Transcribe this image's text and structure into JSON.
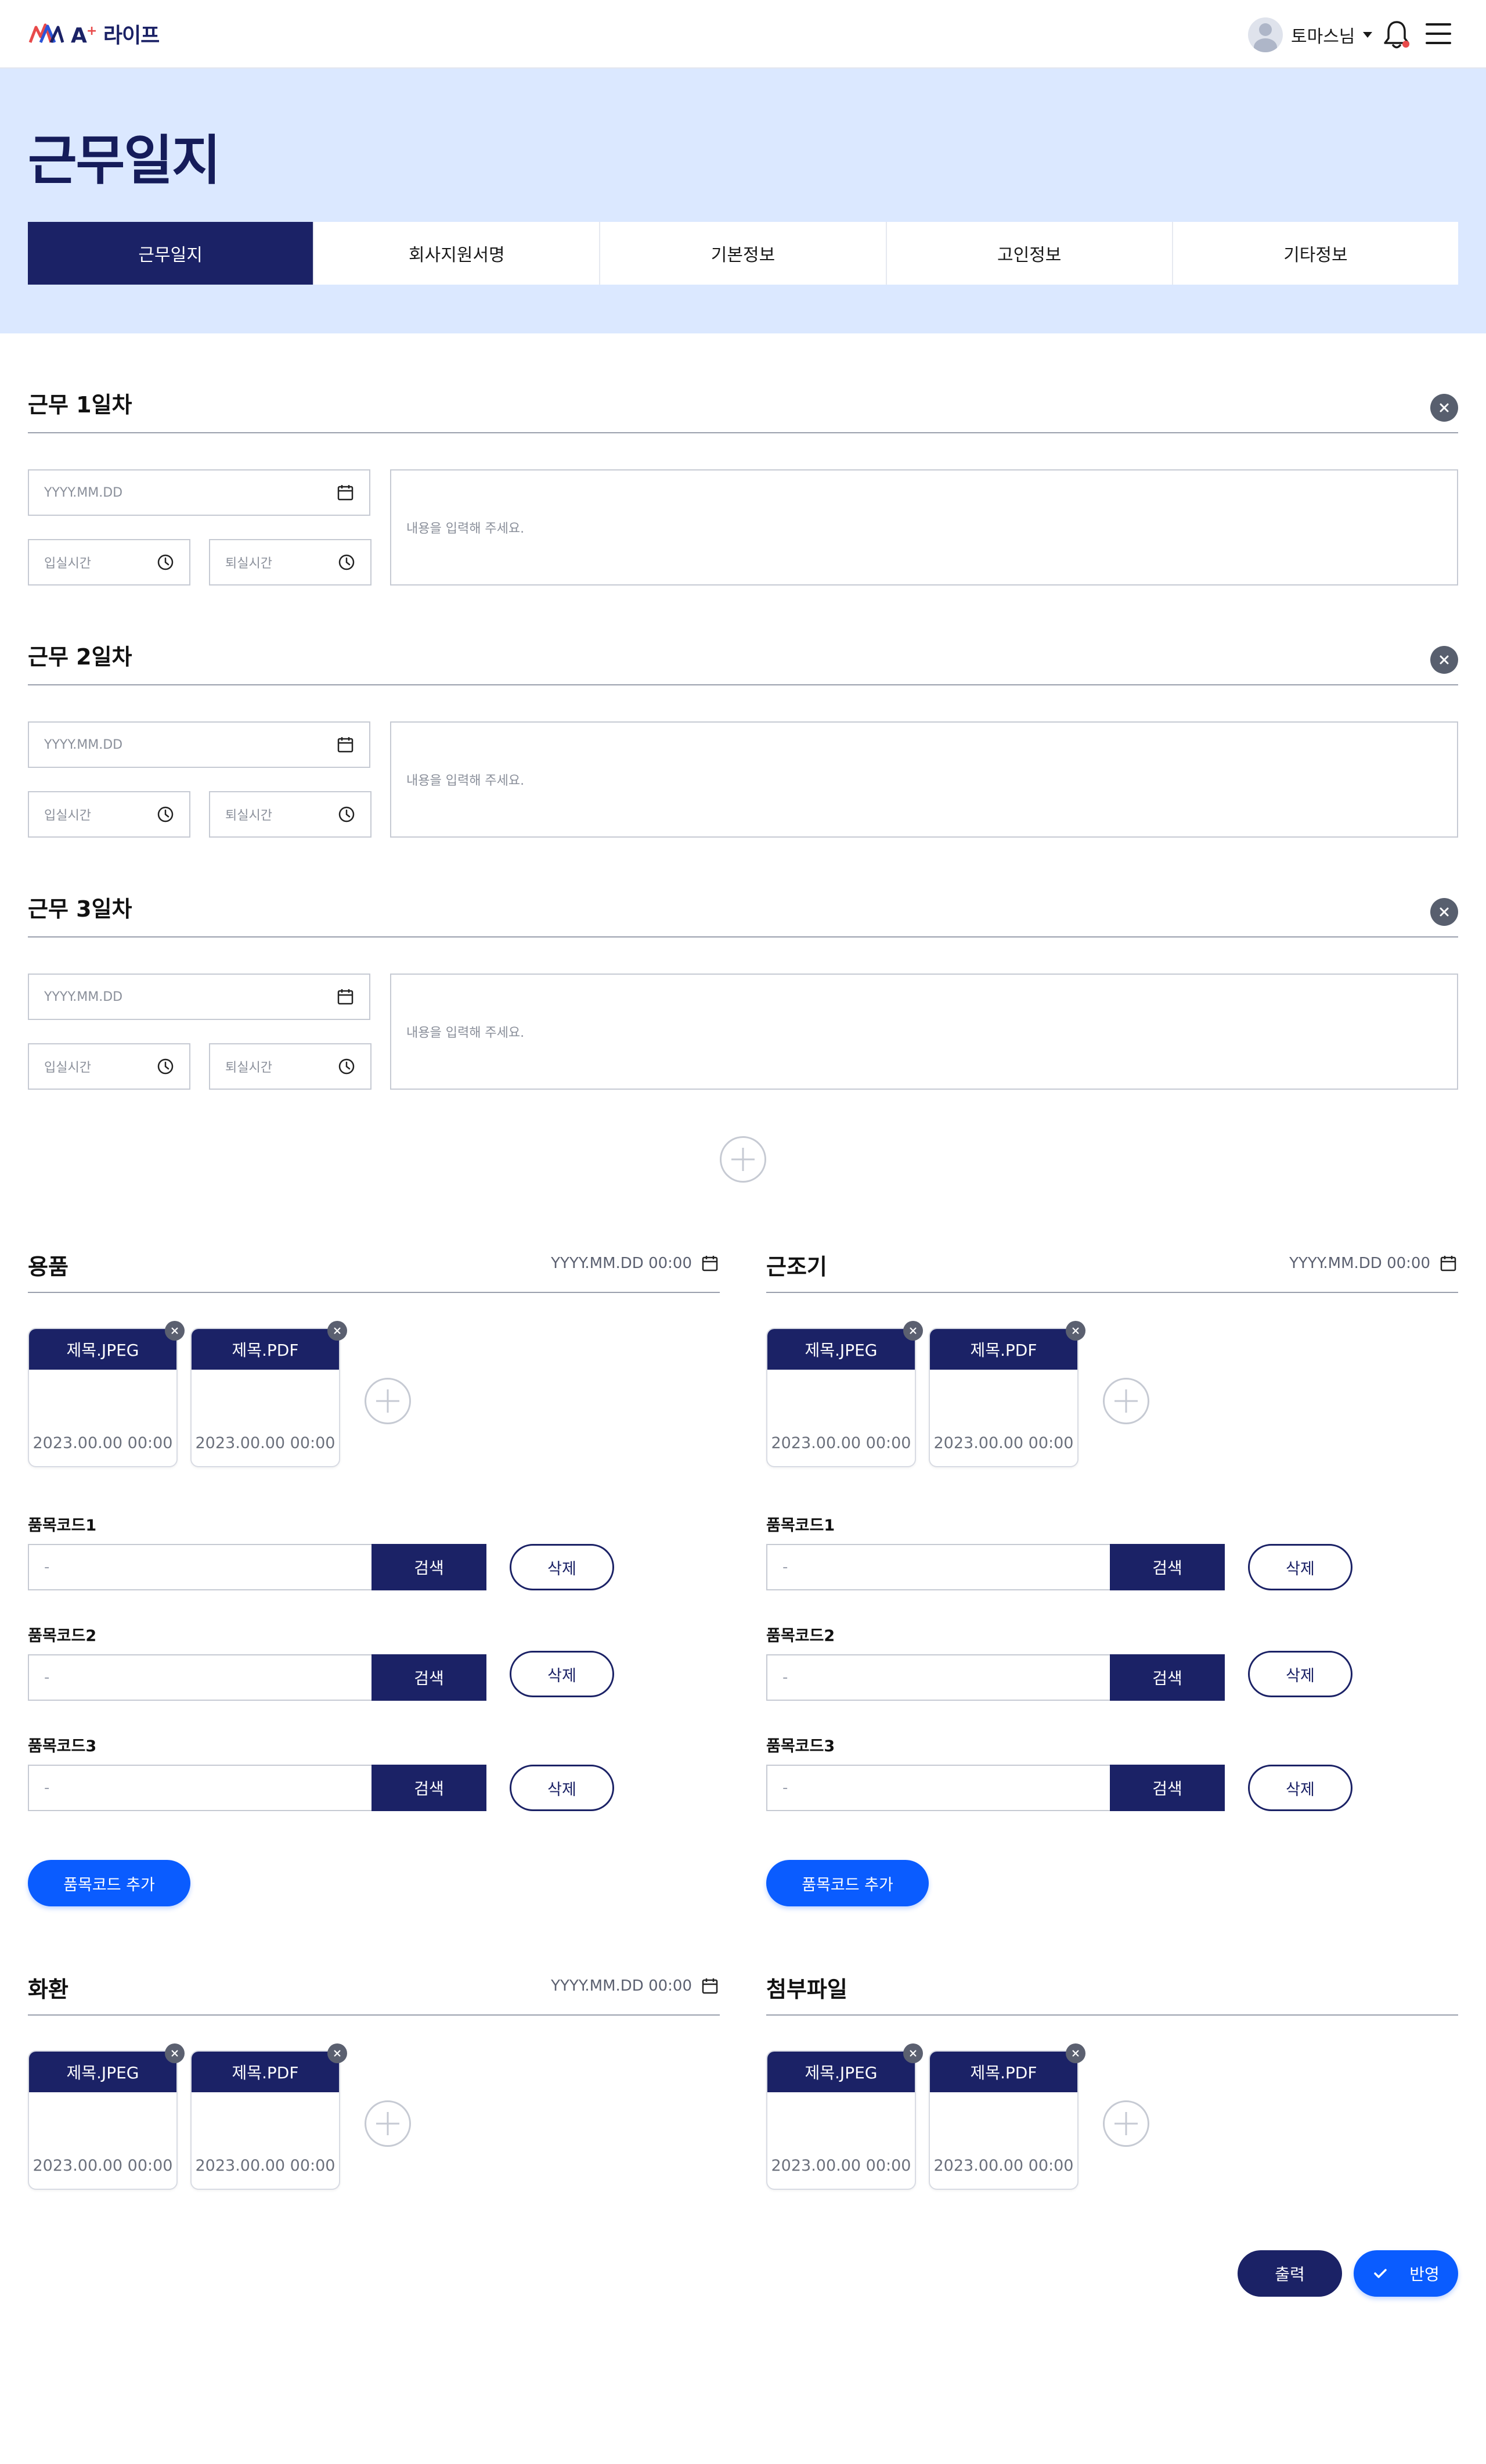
{
  "header": {
    "logo_text": "A",
    "logo_sup": "+",
    "logo_suffix": "라이프",
    "user_name": "토마스님"
  },
  "page": {
    "title": "근무일지"
  },
  "tabs": [
    {
      "label": "근무일지",
      "active": true
    },
    {
      "label": "회사지원서명",
      "active": false
    },
    {
      "label": "기본정보",
      "active": false
    },
    {
      "label": "고인정보",
      "active": false
    },
    {
      "label": "기타정보",
      "active": false
    }
  ],
  "days": [
    {
      "title": "근무 1일차",
      "date_placeholder": "YYYY.MM.DD",
      "in_placeholder": "입실시간",
      "out_placeholder": "퇴실시간",
      "memo_placeholder": "내용을 입력해 주세요."
    },
    {
      "title": "근무 2일차",
      "date_placeholder": "YYYY.MM.DD",
      "in_placeholder": "입실시간",
      "out_placeholder": "퇴실시간",
      "memo_placeholder": "내용을 입력해 주세요."
    },
    {
      "title": "근무 3일차",
      "date_placeholder": "YYYY.MM.DD",
      "in_placeholder": "입실시간",
      "out_placeholder": "퇴실시간",
      "memo_placeholder": "내용을 입력해 주세요."
    }
  ],
  "panels": {
    "supplies": {
      "title": "용품",
      "date": "YYYY.MM.DD 00:00",
      "files": [
        {
          "name": "제목.JPEG",
          "date": "2023.00.00 00:00"
        },
        {
          "name": "제목.PDF",
          "date": "2023.00.00 00:00"
        }
      ],
      "codes": [
        {
          "label": "품목코드1",
          "value": "-",
          "search": "검색",
          "delete": "삭제"
        },
        {
          "label": "품목코드2",
          "value": "-",
          "search": "검색",
          "delete": "삭제"
        },
        {
          "label": "품목코드3",
          "value": "-",
          "search": "검색",
          "delete": "삭제"
        }
      ],
      "add_code": "품목코드 추가"
    },
    "wreath": {
      "title": "근조기",
      "date": "YYYY.MM.DD 00:00",
      "files": [
        {
          "name": "제목.JPEG",
          "date": "2023.00.00 00:00"
        },
        {
          "name": "제목.PDF",
          "date": "2023.00.00 00:00"
        }
      ],
      "codes": [
        {
          "label": "품목코드1",
          "value": "-",
          "search": "검색",
          "delete": "삭제"
        },
        {
          "label": "품목코드2",
          "value": "-",
          "search": "검색",
          "delete": "삭제"
        },
        {
          "label": "품목코드3",
          "value": "-",
          "search": "검색",
          "delete": "삭제"
        }
      ],
      "add_code": "품목코드 추가"
    },
    "exchange": {
      "title": "화환",
      "date": "YYYY.MM.DD 00:00",
      "files": [
        {
          "name": "제목.JPEG",
          "date": "2023.00.00 00:00"
        },
        {
          "name": "제목.PDF",
          "date": "2023.00.00 00:00"
        }
      ]
    },
    "attachments": {
      "title": "첨부파일",
      "files": [
        {
          "name": "제목.JPEG",
          "date": "2023.00.00 00:00"
        },
        {
          "name": "제목.PDF",
          "date": "2023.00.00 00:00"
        }
      ]
    }
  },
  "footer": {
    "print_label": "출력",
    "apply_label": "반영"
  },
  "colors": {
    "navy": "#1b2266",
    "blue": "#0a5cff",
    "hero_bg": "#dbe8ff"
  }
}
